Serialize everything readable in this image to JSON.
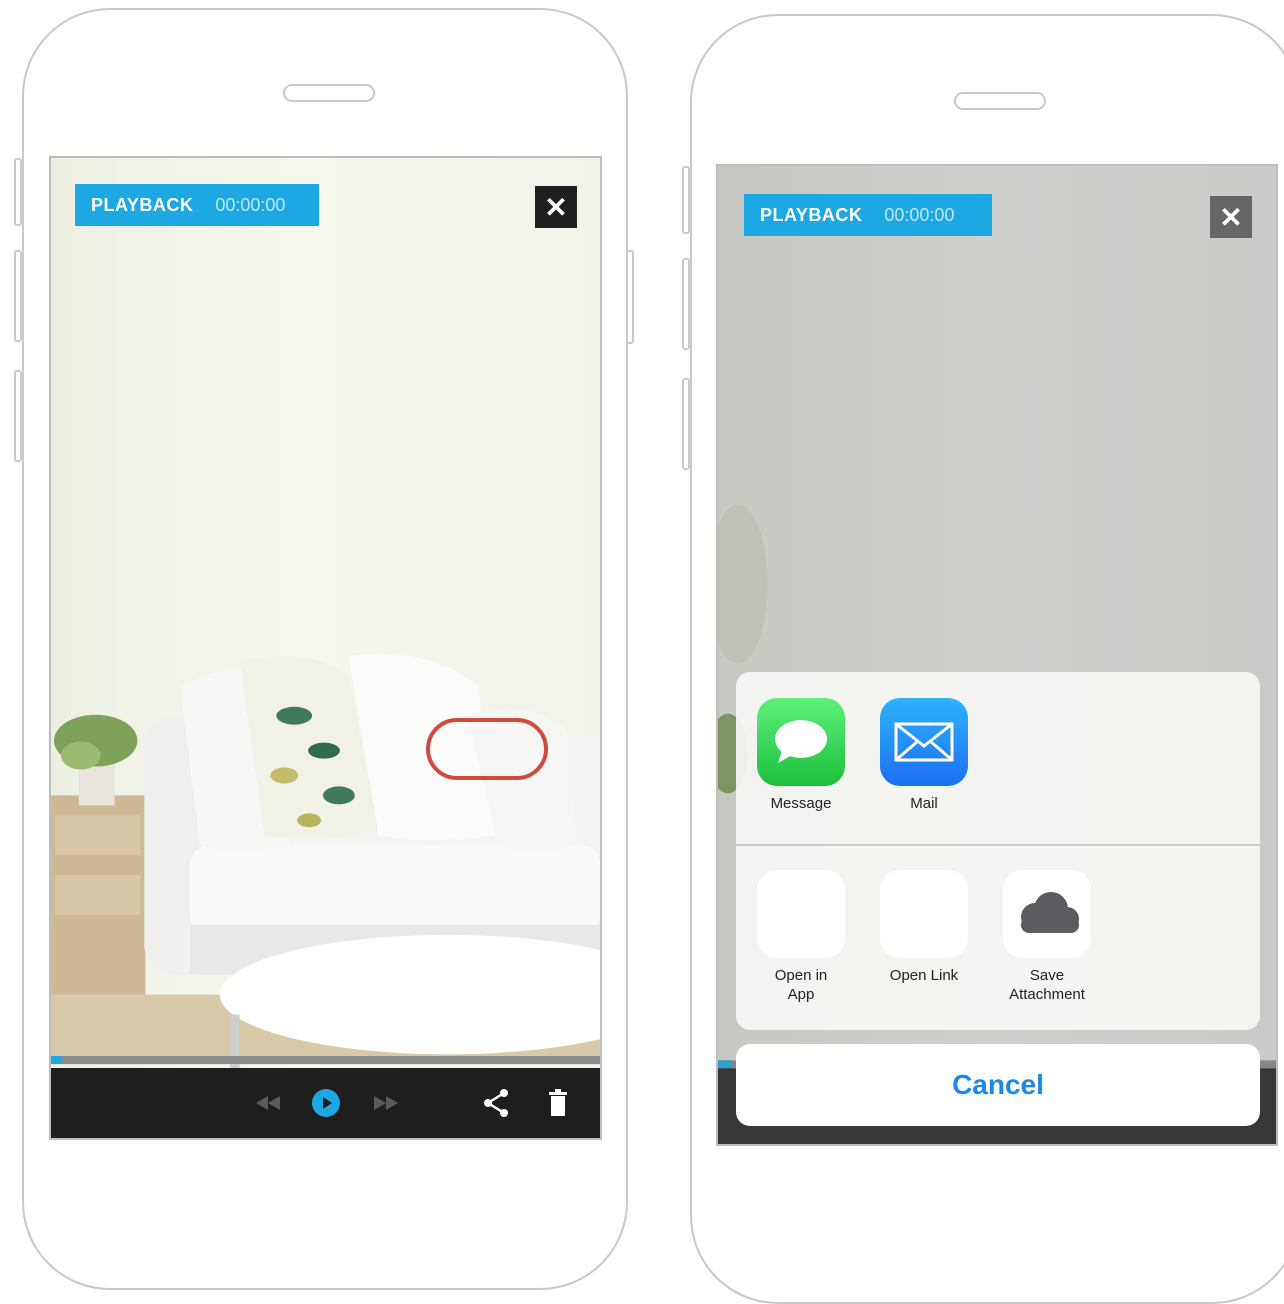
{
  "left_screen": {
    "badge_label": "PLAYBACK",
    "badge_time": "00:00:00",
    "close_glyph": "✕",
    "progress": 0.02,
    "controls": {
      "rewind_icon": "rewind-icon",
      "play_icon": "play-icon",
      "forward_icon": "fast-forward-icon",
      "share_icon": "share-icon",
      "delete_icon": "trash-icon"
    }
  },
  "right_screen": {
    "badge_label": "PLAYBACK",
    "badge_time": "00:00:00",
    "close_glyph": "✕",
    "share_sheet": {
      "row1": [
        {
          "label": "Message",
          "icon": "message-icon"
        },
        {
          "label": "Mail",
          "icon": "mail-icon"
        }
      ],
      "row2": [
        {
          "label": "Open in App",
          "icon": "blank-icon"
        },
        {
          "label": "Open Link",
          "icon": "blank-icon"
        },
        {
          "label": "Save Attachment",
          "icon": "cloud-icon"
        }
      ],
      "cancel_label": "Cancel"
    }
  },
  "colors": {
    "accent": "#1da8e4",
    "highlight": "#d04a40",
    "cancel_text": "#1a88e8",
    "control_bar": "#1e1e1e"
  }
}
